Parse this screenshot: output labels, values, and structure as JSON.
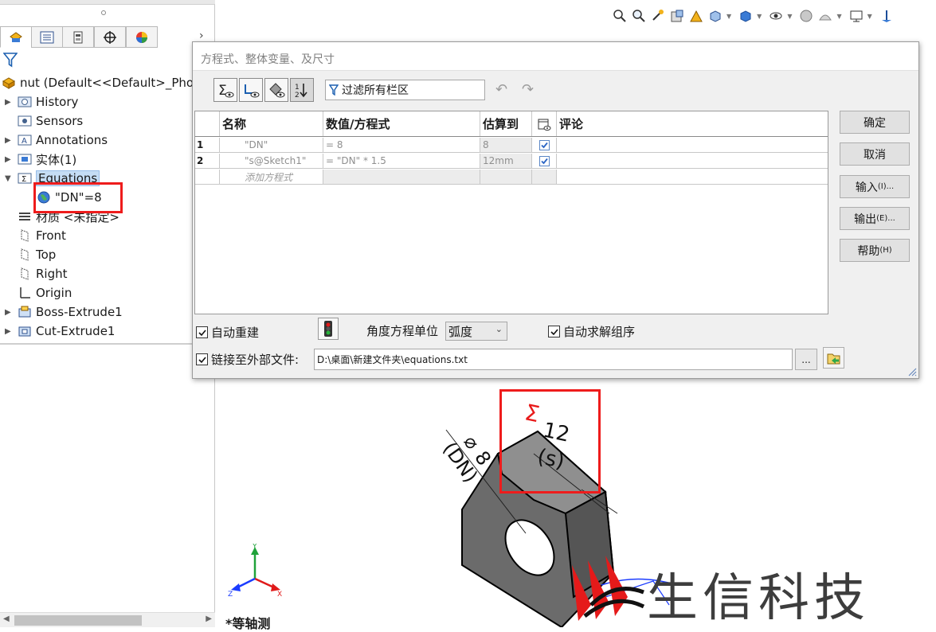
{
  "tree": {
    "root": "nut  (Default<<Default>_Photo",
    "items": [
      "History",
      "Sensors",
      "Annotations",
      "实体(1)",
      "Equations",
      "\"DN\"=8",
      "材质 <未指定>",
      "Front",
      "Top",
      "Right",
      "Origin",
      "Boss-Extrude1",
      "Cut-Extrude1"
    ]
  },
  "dialog": {
    "title": "方程式、整体变量、及尺寸",
    "filter_placeholder": "过滤所有栏区",
    "columns": [
      "名称",
      "数值/方程式",
      "估算到",
      "评论"
    ],
    "rows": [
      {
        "num": "1",
        "name": "\"DN\"",
        "value": "= 8",
        "eval": "8",
        "checked": true,
        "comment": ""
      },
      {
        "num": "2",
        "name": "\"s@Sketch1\"",
        "value": "= \"DN\" * 1.5",
        "eval": "12mm",
        "checked": true,
        "comment": ""
      }
    ],
    "add_row": "添加方程式",
    "buttons": {
      "ok": "确定",
      "cancel": "取消",
      "import": "输入",
      "import_key": "(I)...",
      "export": "输出",
      "export_key": "(E)...",
      "help": "帮助",
      "help_key": "(H)"
    },
    "auto_rebuild": "自动重建",
    "angle_unit_label": "角度方程单位",
    "angle_unit_value": "弧度",
    "auto_solve": "自动求解组序",
    "link_external": "链接至外部文件:",
    "file_path": "D:\\桌面\\新建文件夹\\equations.txt",
    "browse": "..."
  },
  "model": {
    "dim_dn_value": "8",
    "dim_dn_label": "(DN)",
    "dim_s_value": "12",
    "dim_s_label": "(s)",
    "sigma": "Σ"
  },
  "view": {
    "label": "*等轴测"
  },
  "watermark": {
    "text": "生信科技"
  },
  "colors": {
    "accent_red": "#ee1c1c",
    "selection_blue": "#c5ddf5",
    "checkbox_blue": "#2a64c4"
  }
}
